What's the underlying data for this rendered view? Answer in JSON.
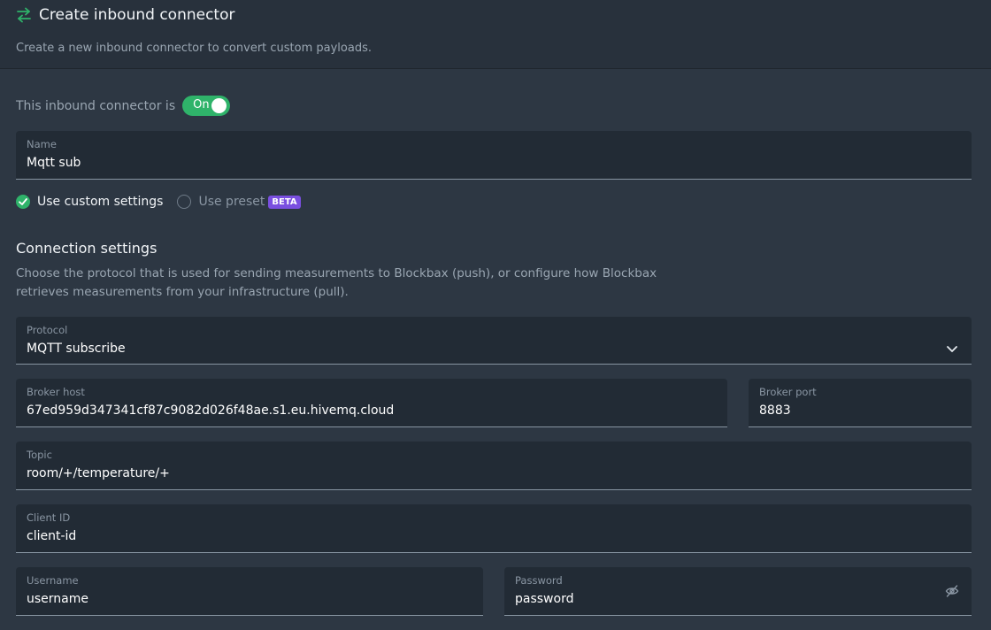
{
  "header": {
    "title": "Create inbound connector",
    "subtitle": "Create a new inbound connector to convert custom payloads."
  },
  "status": {
    "label": "This inbound connector is",
    "toggle_text": "On",
    "enabled": true
  },
  "name_field": {
    "label": "Name",
    "value": "Mqtt sub"
  },
  "mode": {
    "custom_label": "Use custom settings",
    "preset_label": "Use preset",
    "preset_badge": "BETA",
    "selected": "custom"
  },
  "connection": {
    "title": "Connection settings",
    "description": "Choose the protocol that is used for sending measurements to Blockbax (push), or configure how Blockbax retrieves measurements from your infrastructure (pull).",
    "protocol": {
      "label": "Protocol",
      "value": "MQTT subscribe"
    },
    "broker_host": {
      "label": "Broker host",
      "value": "67ed959d347341cf87c9082d026f48ae.s1.eu.hivemq.cloud"
    },
    "broker_port": {
      "label": "Broker port",
      "value": "8883"
    },
    "topic": {
      "label": "Topic",
      "value": "room/+/temperature/+"
    },
    "client_id": {
      "label": "Client ID",
      "value": "client-id"
    },
    "username": {
      "label": "Username",
      "value": "username"
    },
    "password": {
      "label": "Password",
      "value": "password"
    }
  },
  "colors": {
    "accent": "#2fb36a",
    "beta": "#7a4fe0",
    "background": "#2d3743",
    "field": "#222b35"
  }
}
